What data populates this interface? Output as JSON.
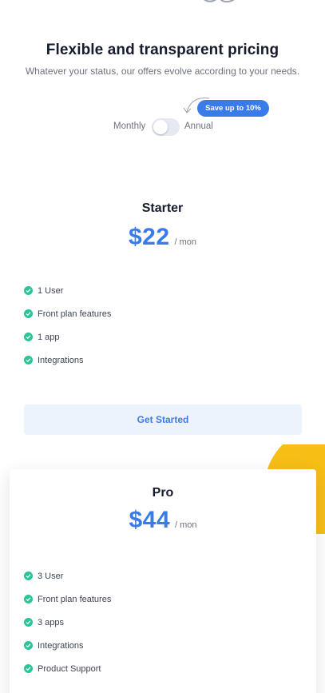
{
  "pricing": {
    "title": "Flexible and transparent pricing",
    "subtitle": "Whatever your status, our offers evolve according to your needs.",
    "save_badge": "Save up to 10%",
    "toggle": {
      "monthly_label": "Monthly",
      "annual_label": "Annual",
      "selected": "Monthly"
    }
  },
  "plans": [
    {
      "name": "Starter",
      "price": "$22",
      "period": "/ mon",
      "features": [
        "1 User",
        "Front plan features",
        "1 app",
        "Integrations"
      ],
      "cta": "Get Started"
    },
    {
      "name": "Pro",
      "price": "$44",
      "period": "/ mon",
      "features": [
        "3 User",
        "Front plan features",
        "3 apps",
        "Integrations",
        "Product Support"
      ]
    }
  ],
  "colors": {
    "accent": "#3a7bec",
    "check": "#2bc59a",
    "decoration": "#f7be16",
    "cta_background": "#edf3fd"
  },
  "icons": {
    "check": "check-circle-icon",
    "arrow": "curved-arrow-icon"
  }
}
